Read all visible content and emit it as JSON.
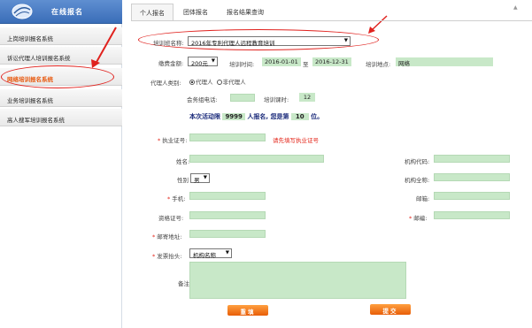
{
  "sidebar": {
    "title": "在线报名",
    "items": [
      {
        "label": "上岗培训报名系统"
      },
      {
        "label": "诉讼代理人培训报名系统"
      },
      {
        "label": "网络培训报名系统"
      },
      {
        "label": "业务培训报名系统"
      },
      {
        "label": "高人搜军培训报名系统"
      }
    ]
  },
  "tabs": [
    {
      "label": "个人报名"
    },
    {
      "label": "团体报名"
    },
    {
      "label": "报名结果查询"
    }
  ],
  "form": {
    "training_name_label": "培训班名称:",
    "training_name_value": "2016年专利代理人远程教育培训",
    "fee_label": "缴费金额:",
    "fee_value": "200元",
    "time_label": "培训时间:",
    "start_date": "2016-01-01",
    "to_text": "至",
    "end_date": "2016-12-31",
    "location_label": "培训地点:",
    "location_value": "网络",
    "agent_type_label": "代理人类别:",
    "agent_option_1": "代理人",
    "agent_option_2": "非代理人",
    "phone_label": "会务组电话:",
    "hours_label": "培训课时:",
    "hours_value": "12",
    "limit_prefix": "本次活动限",
    "limit_value": "9999",
    "limit_mid": "人报名, 您是第",
    "rank_value": "10",
    "rank_suffix": "位。",
    "license_label": "执业证号:",
    "license_hint": "请先填写执业证号",
    "name_label": "姓名:",
    "org_code_label": "机构代码:",
    "gender_label": "性别",
    "gender_value": "男",
    "org_name_label": "机构全称:",
    "mobile_label": "手机:",
    "email_label": "邮箱:",
    "cert_label": "资格证号:",
    "postcode_label": "邮编:",
    "address_label": "邮寄地址:",
    "invoice_label": "发票抬头:",
    "invoice_value": "机构名称",
    "remarks_label": "备注:",
    "reset_button": "重填",
    "submit_button": "提交"
  },
  "colors": {
    "accent": "#3a6db8",
    "field_green": "#c8e8c8",
    "highlight_red": "#e0221e",
    "button_orange": "#f07a20"
  }
}
